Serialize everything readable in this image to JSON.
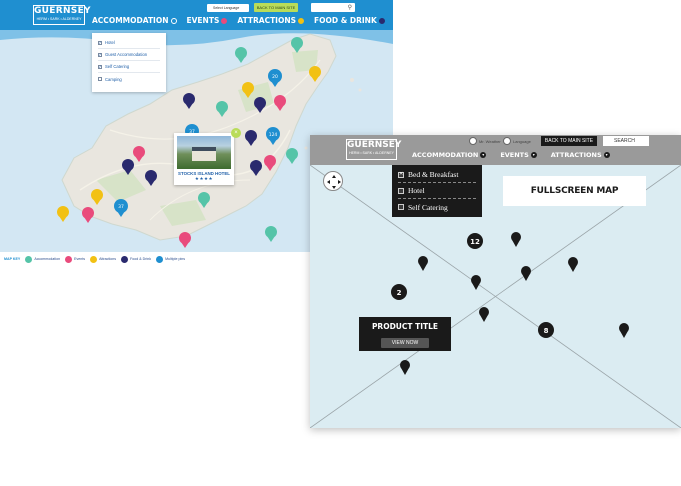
{
  "design": {
    "logo": {
      "name": "GUERNSEY",
      "tagline": "HERM • SARK • ALDERNEY"
    },
    "header": {
      "language_label": "Select Language",
      "back_label": "BACK TO MAIN SITE"
    },
    "nav": [
      {
        "label": "ACCOMMODATION",
        "dot": "outline"
      },
      {
        "label": "EVENTS",
        "dot": "pink"
      },
      {
        "label": "ATTRACTIONS",
        "dot": "yellow"
      },
      {
        "label": "FOOD & DRINK",
        "dot": "navy"
      }
    ],
    "dropdown": [
      {
        "label": "Hotel",
        "checked": true
      },
      {
        "label": "Guest Accommodation",
        "checked": true
      },
      {
        "label": "Self Catering",
        "checked": true
      },
      {
        "label": "Camping",
        "checked": false
      }
    ],
    "popup": {
      "title": "STOCKS ISLAND HOTEL",
      "stars": "★★★★",
      "close": "×"
    },
    "key": {
      "label": "MAP KEY",
      "items": [
        {
          "label": "Accommodation",
          "color": "#55c4a8"
        },
        {
          "label": "Events",
          "color": "#e94b7c"
        },
        {
          "label": "Attractions",
          "color": "#f2c114"
        },
        {
          "label": "Food & Drink",
          "color": "#2a2a6e"
        },
        {
          "label": "Multiple pins",
          "color": "#1f8fd0"
        }
      ]
    },
    "cluster_counts": [
      "20",
      "37",
      "124",
      "37"
    ],
    "colors": {
      "header": "#1f8fd0",
      "back_button": "#b9dc59",
      "sea": "#d3e7f3",
      "land": "#e9e6df"
    }
  },
  "wireframe": {
    "logo": {
      "name": "GUERNSEY",
      "tagline": "HERM • SARK • ALDERNEY"
    },
    "radios": [
      {
        "label": "Mr. Weather"
      },
      {
        "label": "Language"
      }
    ],
    "back_label": "BACK TO MAIN SITE",
    "search_label": "SEARCH",
    "nav": [
      {
        "label": "ACCOMMODATION"
      },
      {
        "label": "EVENTS"
      },
      {
        "label": "ATTRACTIONS"
      }
    ],
    "dropdown": [
      {
        "label": "Bed & Breakfast",
        "checked": true
      },
      {
        "label": "Hotel",
        "checked": false
      },
      {
        "label": "Self Catering",
        "checked": false
      }
    ],
    "fullscreen_label": "FULLSCREEN MAP",
    "product": {
      "title": "PRODUCT TITLE",
      "button": "VIEW NOW"
    },
    "cluster_counts": [
      "12",
      "2",
      "8"
    ]
  }
}
